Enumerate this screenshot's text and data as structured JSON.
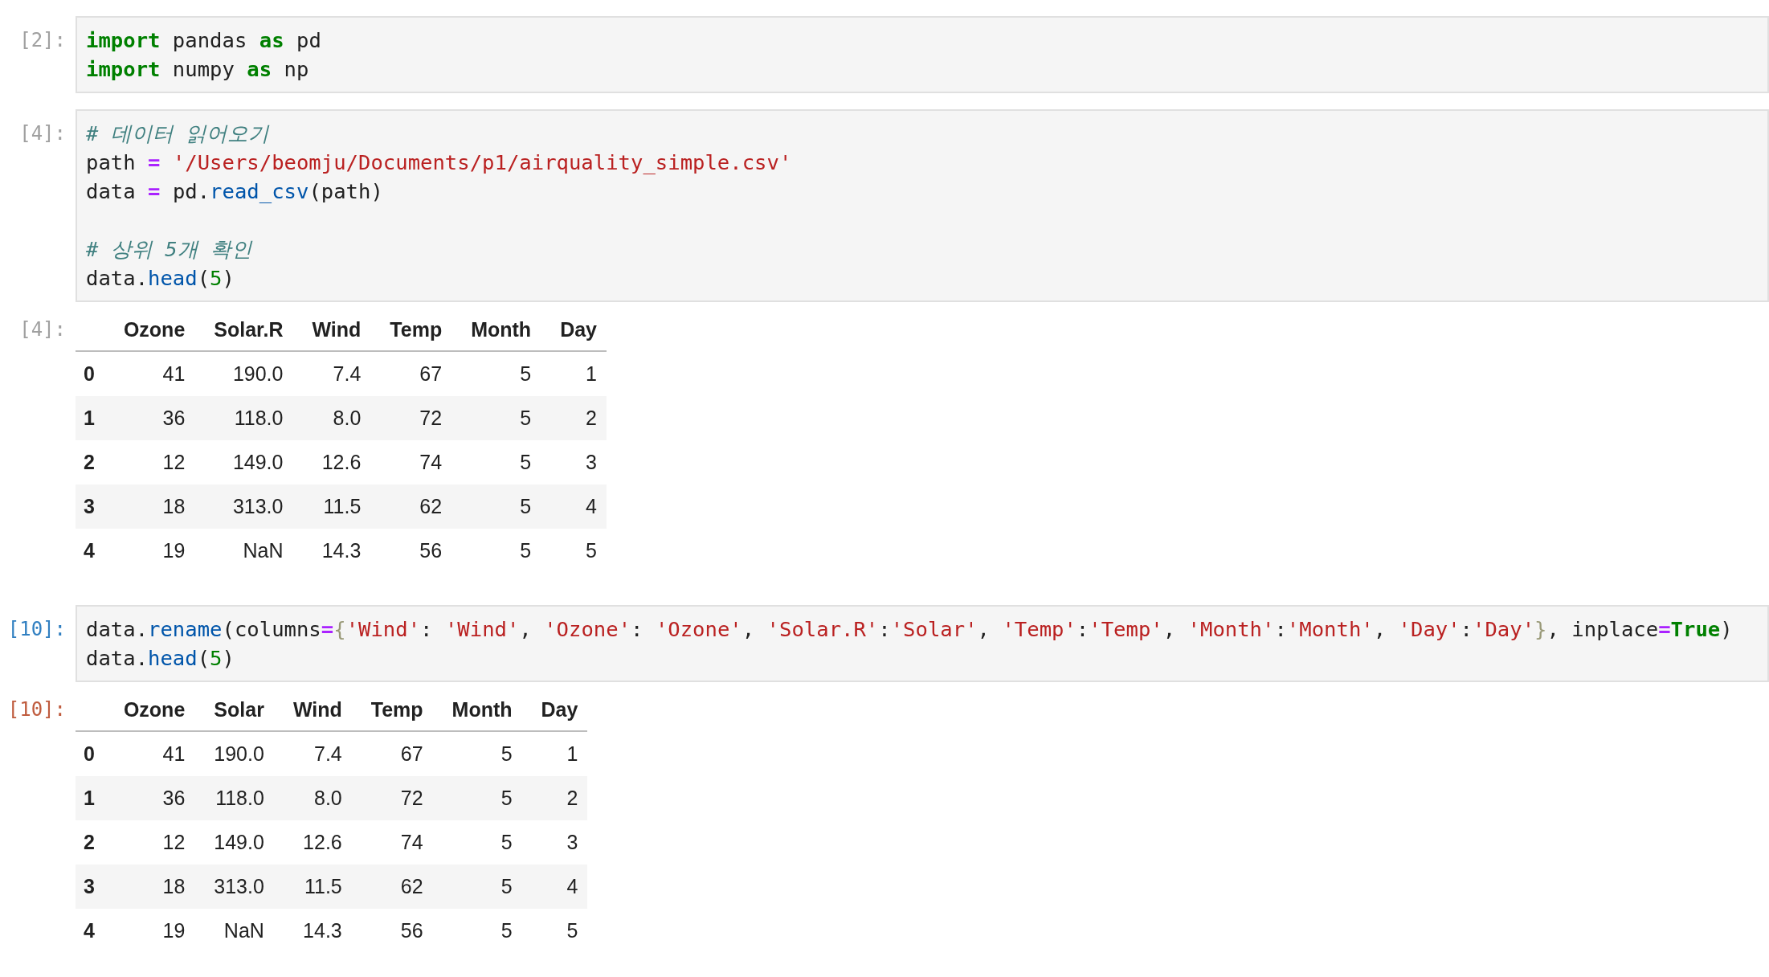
{
  "cells": [
    {
      "selected": false,
      "input": {
        "prompt": "[2]:",
        "lines": [
          {
            "tokens": [
              {
                "kind": "kw",
                "text": "import"
              },
              {
                "kind": "plain",
                "text": " pandas "
              },
              {
                "kind": "kw",
                "text": "as"
              },
              {
                "kind": "plain",
                "text": " pd"
              }
            ]
          },
          {
            "tokens": [
              {
                "kind": "kw",
                "text": "import"
              },
              {
                "kind": "plain",
                "text": " numpy "
              },
              {
                "kind": "kw",
                "text": "as"
              },
              {
                "kind": "plain",
                "text": " np"
              }
            ]
          }
        ]
      }
    },
    {
      "selected": false,
      "input": {
        "prompt": "[4]:",
        "lines": [
          {
            "tokens": [
              {
                "kind": "comment",
                "text": "# 데이터 읽어오기"
              }
            ]
          },
          {
            "tokens": [
              {
                "kind": "plain",
                "text": "path "
              },
              {
                "kind": "op",
                "text": "="
              },
              {
                "kind": "str",
                "text": " '/Users/beomju/Documents/p1/airquality_simple.csv'"
              }
            ]
          },
          {
            "tokens": [
              {
                "kind": "plain",
                "text": "data "
              },
              {
                "kind": "op",
                "text": "="
              },
              {
                "kind": "plain",
                "text": " pd."
              },
              {
                "kind": "fn",
                "text": "read_csv"
              },
              {
                "kind": "plain",
                "text": "(path)"
              }
            ]
          },
          {
            "kind": "blank"
          },
          {
            "kind": "code",
            "tokens": [
              {
                "kind": "comment",
                "text": "# 상위 5개 확인"
              }
            ]
          },
          {
            "tokens": [
              {
                "kind": "plain",
                "text": "data."
              },
              {
                "kind": "fn",
                "text": "head"
              },
              {
                "kind": "plain",
                "text": "("
              },
              {
                "kind": "num",
                "text": "5"
              },
              {
                "kind": "plain",
                "text": ")"
              }
            ]
          }
        ]
      },
      "output": {
        "prompt": "[4]:",
        "columns": [
          "Ozone",
          "Solar.R",
          "Wind",
          "Temp",
          "Month",
          "Day"
        ],
        "rows": [
          {
            "index": "0",
            "values": [
              "41",
              "190.0",
              "7.4",
              "67",
              "5",
              "1"
            ]
          },
          {
            "index": "1",
            "values": [
              "36",
              "118.0",
              "8.0",
              "72",
              "5",
              "2"
            ]
          },
          {
            "index": "2",
            "values": [
              "12",
              "149.0",
              "12.6",
              "74",
              "5",
              "3"
            ]
          },
          {
            "index": "3",
            "values": [
              "18",
              "313.0",
              "11.5",
              "62",
              "5",
              "4"
            ]
          },
          {
            "index": "4",
            "values": [
              "19",
              "NaN",
              "14.3",
              "56",
              "5",
              "5"
            ]
          }
        ]
      }
    },
    {
      "selected": true,
      "input": {
        "prompt": "[10]:",
        "lines": [
          {
            "tokens": [
              {
                "kind": "plain",
                "text": "data."
              },
              {
                "kind": "fn",
                "text": "rename"
              },
              {
                "kind": "plain",
                "text": "(columns"
              },
              {
                "kind": "op",
                "text": "="
              },
              {
                "kind": "brace",
                "text": "{"
              },
              {
                "kind": "str",
                "text": "'Wind'"
              },
              {
                "kind": "plain",
                "text": ": "
              },
              {
                "kind": "str",
                "text": "'Wind'"
              },
              {
                "kind": "plain",
                "text": ", "
              },
              {
                "kind": "str",
                "text": "'Ozone'"
              },
              {
                "kind": "plain",
                "text": ": "
              },
              {
                "kind": "str",
                "text": "'Ozone'"
              },
              {
                "kind": "plain",
                "text": ", "
              },
              {
                "kind": "str",
                "text": "'Solar.R'"
              },
              {
                "kind": "plain",
                "text": ":"
              },
              {
                "kind": "str",
                "text": "'Solar'"
              },
              {
                "kind": "plain",
                "text": ", "
              },
              {
                "kind": "str",
                "text": "'Temp'"
              },
              {
                "kind": "plain",
                "text": ":"
              },
              {
                "kind": "str",
                "text": "'Temp'"
              },
              {
                "kind": "plain",
                "text": ", "
              },
              {
                "kind": "str",
                "text": "'Month'"
              },
              {
                "kind": "plain",
                "text": ":"
              },
              {
                "kind": "str",
                "text": "'Month'"
              },
              {
                "kind": "plain",
                "text": ", "
              },
              {
                "kind": "str",
                "text": "'Day'"
              },
              {
                "kind": "plain",
                "text": ":"
              },
              {
                "kind": "str",
                "text": "'Day'"
              },
              {
                "kind": "brace",
                "text": "}"
              },
              {
                "kind": "plain",
                "text": ", inplace"
              },
              {
                "kind": "op",
                "text": "="
              },
              {
                "kind": "kw",
                "text": "True"
              },
              {
                "kind": "plain",
                "text": ")"
              }
            ]
          },
          {
            "tokens": [
              {
                "kind": "plain",
                "text": "data."
              },
              {
                "kind": "fn",
                "text": "head"
              },
              {
                "kind": "plain",
                "text": "("
              },
              {
                "kind": "num",
                "text": "5"
              },
              {
                "kind": "plain",
                "text": ")"
              }
            ]
          }
        ]
      },
      "output": {
        "prompt": "[10]:",
        "columns": [
          "Ozone",
          "Solar",
          "Wind",
          "Temp",
          "Month",
          "Day"
        ],
        "rows": [
          {
            "index": "0",
            "values": [
              "41",
              "190.0",
              "7.4",
              "67",
              "5",
              "1"
            ]
          },
          {
            "index": "1",
            "values": [
              "36",
              "118.0",
              "8.0",
              "72",
              "5",
              "2"
            ]
          },
          {
            "index": "2",
            "values": [
              "12",
              "149.0",
              "12.6",
              "74",
              "5",
              "3"
            ]
          },
          {
            "index": "3",
            "values": [
              "18",
              "313.0",
              "11.5",
              "62",
              "5",
              "4"
            ]
          },
          {
            "index": "4",
            "values": [
              "19",
              "NaN",
              "14.3",
              "56",
              "5",
              "5"
            ]
          }
        ]
      }
    }
  ]
}
